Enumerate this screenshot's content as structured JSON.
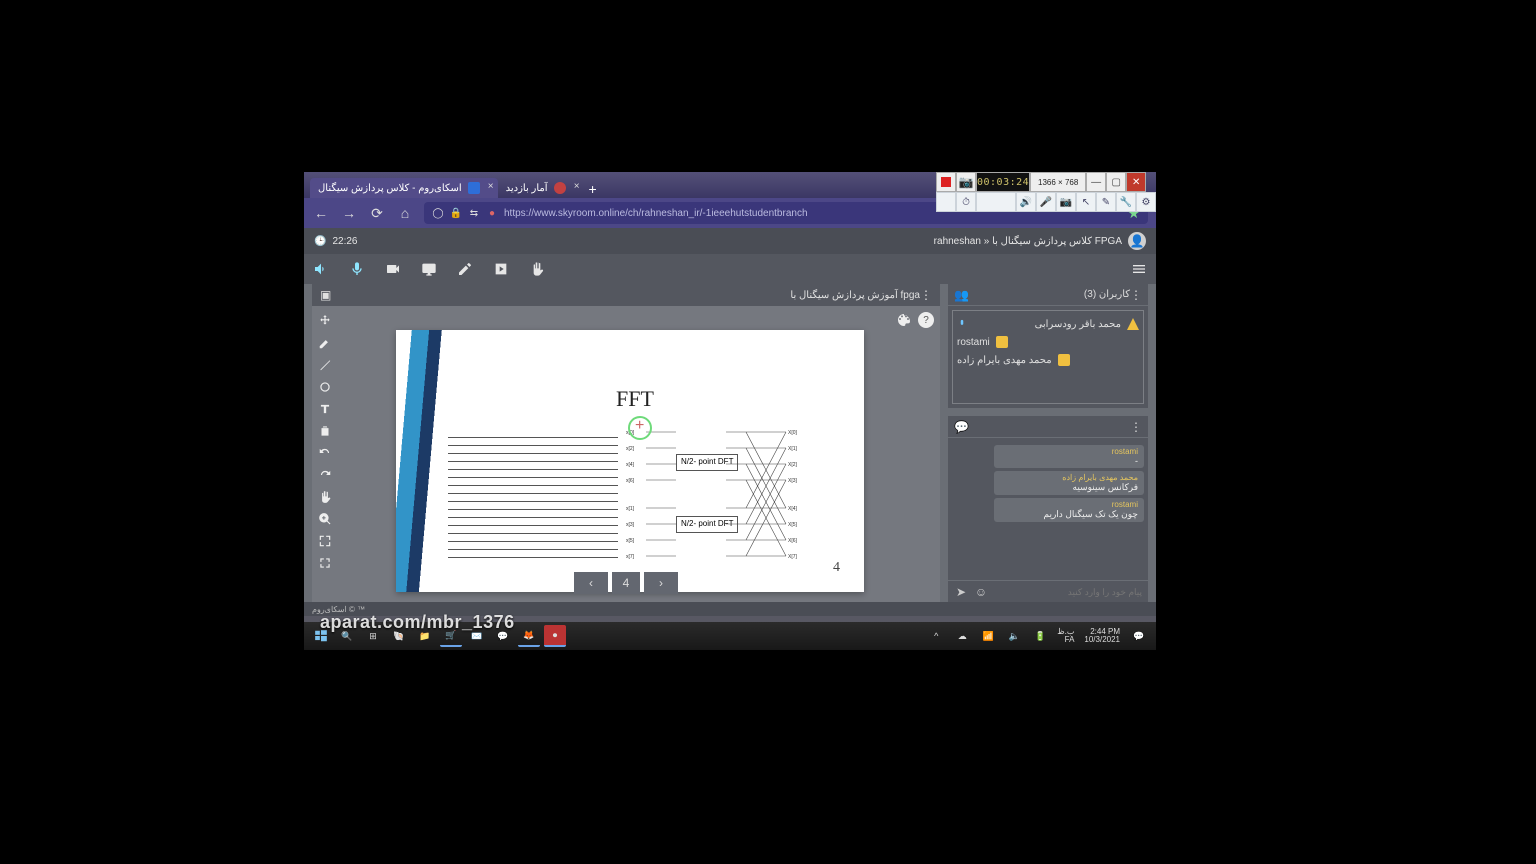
{
  "browser": {
    "tabs": [
      {
        "label": "اسکای‌روم - کلاس پردازش سیگنال",
        "active": true
      },
      {
        "label": "آمار بازدید",
        "active": false
      }
    ],
    "url": "https://www.skyroom.online/ch/rahneshan_ir/-1ieeehutstudentbranch"
  },
  "recorder": {
    "time": "00:03:24",
    "dimensions": "1366 × 768"
  },
  "skyroom": {
    "timer": "22:26",
    "breadcrumb": "rahneshan » کلاس پردازش سیگنال با FPGA",
    "present_title": "آموزش پردازش سیگنال با fpga",
    "pager": {
      "page": "4"
    },
    "slide": {
      "title": "FFT",
      "dft_label": "N/2- point\nDFT",
      "page": "4"
    },
    "users": {
      "header": "کاربران (3)",
      "list": [
        {
          "name": "محمد باقر رودسرابی",
          "role": "presenter",
          "mic": true
        },
        {
          "name": "rostami",
          "role": "user",
          "mic": false
        },
        {
          "name": "محمد مهدی بایرام زاده",
          "role": "user",
          "mic": false
        }
      ]
    },
    "chat": {
      "messages": [
        {
          "name": "rostami",
          "text": "-"
        },
        {
          "name": "محمد مهدی بایرام زاده",
          "text": "فرکانس سینوسیه"
        },
        {
          "name": "rostami",
          "text": "چون یک تک سیگنال داریم"
        }
      ],
      "placeholder": "پیام خود را وارد کنید"
    },
    "footer": "اسکای‌روم © ™"
  },
  "taskbar": {
    "time": "2:44 PM",
    "date": "10/3/2021",
    "lang1": "ب.ظ",
    "lang2": "FA"
  },
  "watermark": "aparat.com/mbr_1376"
}
